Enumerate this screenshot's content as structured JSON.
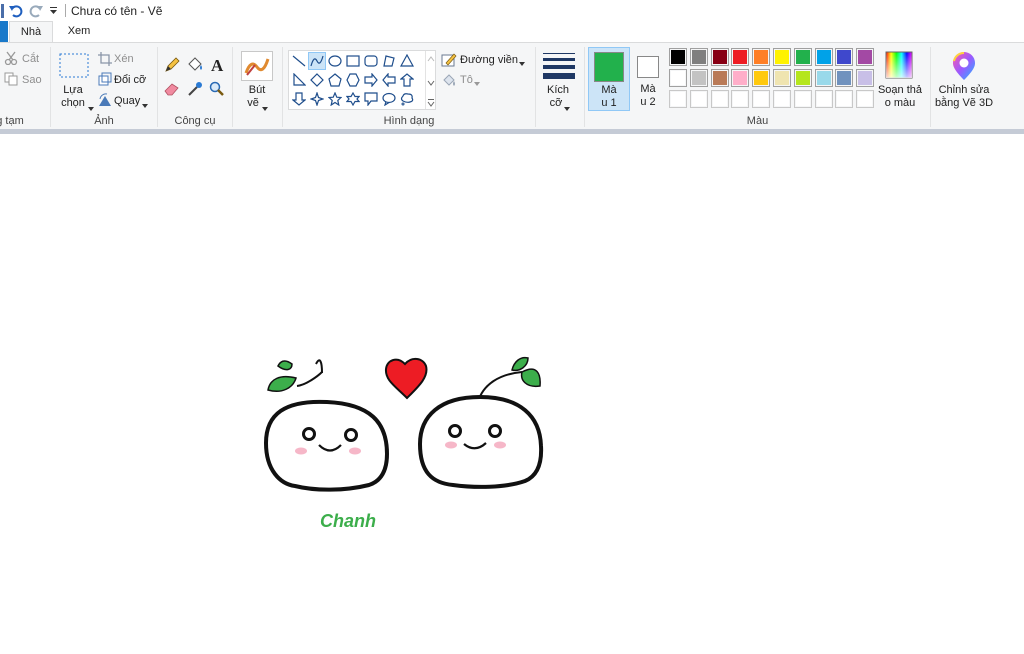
{
  "window": {
    "title": "Chưa có tên - Vẽ"
  },
  "tabs": [
    {
      "label": "Nhà",
      "active": true
    },
    {
      "label": "Xem",
      "active": false
    }
  ],
  "ribbon": {
    "clipboard": {
      "label": "g tạm",
      "cut": "Cắt",
      "copy": "Sao"
    },
    "image": {
      "label": "Ảnh",
      "select_line1": "Lựa",
      "select_line2": "chọn",
      "crop": "Xén",
      "resize": "Đổi cỡ",
      "rotate": "Quay"
    },
    "tools": {
      "label": "Công cụ"
    },
    "brushes": {
      "line1": "Bút",
      "line2": "vẽ"
    },
    "shapes": {
      "label": "Hình dạng",
      "outline": "Đường viền",
      "fill": "Tô",
      "selected_shape": "curve"
    },
    "size": {
      "line1": "Kích",
      "line2": "cỡ"
    },
    "colors": {
      "label": "Màu",
      "color1_line1": "Mà",
      "color1_line2": "u 1",
      "color1_value": "#22b14c",
      "color2_line1": "Mà",
      "color2_line2": "u 2",
      "color2_value": "#ffffff",
      "edit_line1": "Soạn thả",
      "edit_line2": "o màu",
      "row1": [
        "#000000",
        "#7f7f7f",
        "#880015",
        "#ed1c24",
        "#ff7f27",
        "#fff200",
        "#22b14c",
        "#00a2e8",
        "#3f48cc",
        "#a349a4"
      ],
      "row2": [
        "#ffffff",
        "#c3c3c3",
        "#b97a57",
        "#ffaec9",
        "#ffc90e",
        "#efe4b0",
        "#b5e61d",
        "#99d9ea",
        "#7092be",
        "#c8bfe7"
      ],
      "row3": [
        "#ffffff",
        "#ffffff",
        "#ffffff",
        "#ffffff",
        "#ffffff",
        "#ffffff",
        "#ffffff",
        "#ffffff",
        "#ffffff",
        "#ffffff"
      ]
    },
    "paint3d": {
      "line1": "Chỉnh sửa",
      "line2": "bằng Vẽ 3D"
    }
  },
  "canvas": {
    "caption": "Chanh",
    "caption_color": "#3cae4b",
    "heart_color": "#ed1c24",
    "leaf_color": "#3cae4b"
  }
}
